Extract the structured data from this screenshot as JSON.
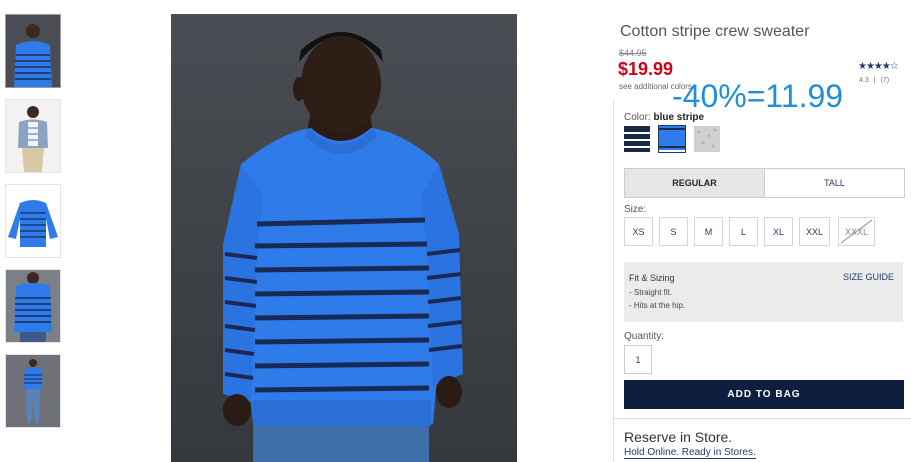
{
  "product": {
    "title": "Cotton stripe crew sweater",
    "original_price": "$44.95",
    "sale_price": "$19.99",
    "see_colors": "see additional colors",
    "rating_stars": "★★★★☆",
    "rating_value": "4.3",
    "rating_sep": "|",
    "review_count": "(7)"
  },
  "annotation": "-40%=11.99",
  "color": {
    "label": "Color:",
    "selected": "blue stripe",
    "swatches": [
      {
        "name": "navy stripe",
        "primary": "#1c2a4a",
        "stripe": "#ffffff"
      },
      {
        "name": "blue stripe",
        "primary": "#2f7bea",
        "stripe": "#1a2a55"
      },
      {
        "name": "grey heather",
        "primary": "#c9c9c9",
        "stripe": "#b0b0b0"
      }
    ]
  },
  "fit": {
    "regular": "REGULAR",
    "tall": "TALL"
  },
  "size": {
    "label": "Size:",
    "options": [
      "XS",
      "S",
      "M",
      "L",
      "XL",
      "XXL",
      "XXXL"
    ],
    "unavailable": [
      "XXXL"
    ]
  },
  "fit_sizing": {
    "title": "Fit & Sizing",
    "guide_link": "SIZE GUIDE",
    "details": [
      "- Straight fit.",
      "- Hits at the hip."
    ]
  },
  "quantity": {
    "label": "Quantity:",
    "value": "1"
  },
  "add_to_bag": "ADD TO BAG",
  "reserve": {
    "title": "Reserve in Store.",
    "subtitle": "Hold Online. Ready in Stores."
  },
  "colors": {
    "accent_navy": "#0e1e3f",
    "sale_red": "#d0021b",
    "annotation_blue": "#1f8fd6",
    "sweater_blue": "#2f7bea"
  }
}
